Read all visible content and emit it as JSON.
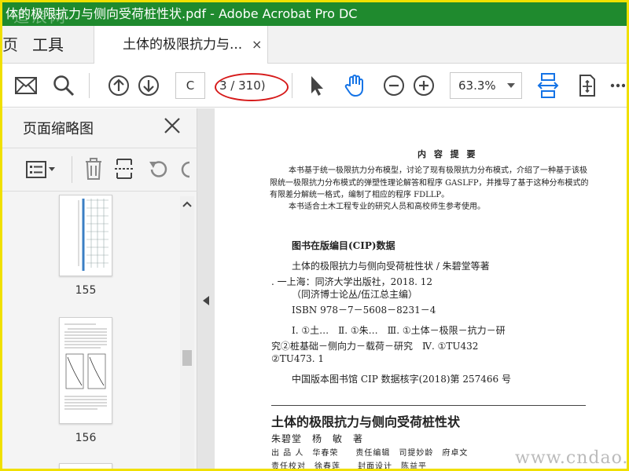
{
  "window": {
    "title": "体的极限抗力与侧向受荷桩性状.pdf - Adobe Acrobat Pro DC",
    "watermark_top_left": "造浪网"
  },
  "tabs": {
    "home_label": "页",
    "tools_label": "工具",
    "doc_label": "土体的极限抗力与...",
    "close_glyph": "×"
  },
  "toolbar": {
    "page_input": "C",
    "page_count": "3 / 310)",
    "zoom_value": "63.3%"
  },
  "left_panel": {
    "title": "页面缩略图",
    "thumbnails": [
      {
        "page_label": "155"
      },
      {
        "page_label": "156"
      }
    ]
  },
  "document": {
    "heading": "内 容 提 要",
    "abstract_paragraphs": [
      "本书基于统一极限抗力分布模型，讨论了现有极限抗力分布模式，介绍了一种基于该极限统一极限抗力分布模式的弹塑性理论解答和程序 GASLFP，并推导了基于这种分布模式的有限差分解统一格式，编制了相应的程序 FDLLP。",
      "本书适合土木工程专业的研究人员和高校师生参考使用。"
    ],
    "cip_title": "图书在版编目(CIP)数据",
    "cip_lines": [
      "土体的极限抗力与侧向受荷桩性状 / 朱碧堂等著",
      ". 一上海：同济大学出版社，2018. 12",
      "（同济博士论丛/伍江总主编）",
      "ISBN 978－7－5608－8231－4"
    ],
    "cip_class_lines": [
      "Ⅰ. ①土…　Ⅱ. ①朱…　Ⅲ. ①土体－极限－抗力－研",
      "究②桩基础－侧向力－载荷－研究　Ⅳ. ①TU432",
      "②TU473. 1"
    ],
    "cip_number": "中国版本图书馆 CIP 数据核字(2018)第 257466 号",
    "book_title": "土体的极限抗力与侧向受荷桩性状",
    "authors": "朱碧堂　杨　敏　著",
    "credit_line_1": "出 品 人　华春荣　　责任编辑　司提妙龄　府卓文",
    "credit_line_2": "责任校对　徐春莲　　封面设计　陈益平"
  },
  "watermark_bottom_right": "www.cndao.com",
  "colors": {
    "titlebar_green": "#1f8a2e",
    "frame_yellow": "#f0e000",
    "accent_blue": "#1473e6",
    "annotation_red": "#d61a1a"
  }
}
